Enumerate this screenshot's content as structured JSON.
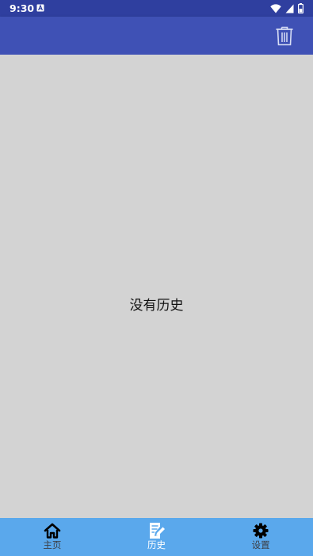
{
  "status_bar": {
    "time": "9:30",
    "notification_icon": "a-notification-icon",
    "icons": [
      "wifi-icon",
      "cell-signal-icon",
      "battery-icon"
    ]
  },
  "app_bar": {
    "title": "",
    "action_icon": "trash-icon"
  },
  "content": {
    "empty_message": "没有历史"
  },
  "bottom_nav": {
    "items": [
      {
        "label": "主页",
        "icon": "home-icon",
        "active": false
      },
      {
        "label": "历史",
        "icon": "history-note-icon",
        "active": true
      },
      {
        "label": "设置",
        "icon": "gear-icon",
        "active": false
      }
    ]
  },
  "colors": {
    "status_bar": "#2f3f9f",
    "app_bar": "#3f51b5",
    "content_bg": "#d3d3d3",
    "bottom_nav": "#5aa8ec",
    "active_label": "#ffffff",
    "inactive_label": "#3c3f46"
  }
}
